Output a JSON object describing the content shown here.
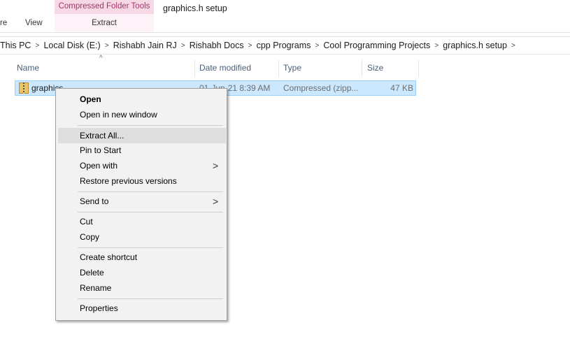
{
  "ribbon": {
    "tab_share_partial": "re",
    "tab_view": "View",
    "tool_group_title": "Compressed Folder Tools",
    "tool_group_tab": "Extract",
    "window_title": "graphics.h setup"
  },
  "address": {
    "crumbs": [
      "This PC",
      "Local Disk (E:)",
      "Rishabh Jain RJ",
      "Rishabh Docs",
      "cpp Programs",
      "Cool Programming Projects",
      "graphics.h setup"
    ],
    "separator": ">"
  },
  "columns": {
    "name": "Name",
    "date_modified": "Date modified",
    "type": "Type",
    "size": "Size",
    "sort_indicator": "^"
  },
  "file": {
    "name": "graphics",
    "date_modified": "01-Jun-21 8:39 AM",
    "type": "Compressed (zipp...",
    "size": "47 KB",
    "icon": "zip-folder-icon",
    "highlight_color": "#cce8ff"
  },
  "context_menu": {
    "items": [
      "Open",
      "Open in new window",
      "Extract All...",
      "Pin to Start",
      "Open with",
      "Restore previous versions",
      "Send to",
      "Cut",
      "Copy",
      "Create shortcut",
      "Delete",
      "Rename",
      "Properties"
    ],
    "submenu_arrow": ">",
    "hovered_item": "Extract All..."
  }
}
